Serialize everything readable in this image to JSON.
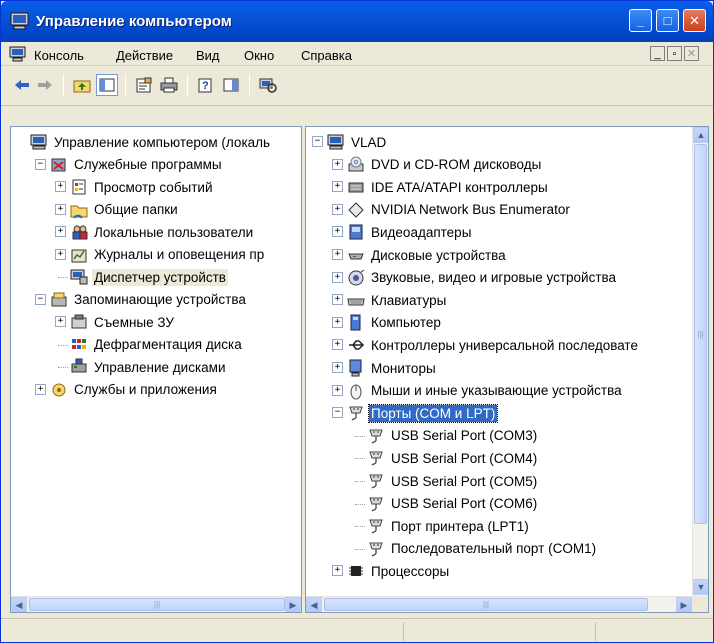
{
  "window": {
    "title": "Управление компьютером",
    "minimize": "_",
    "maximize": "□",
    "close": "✕"
  },
  "menu": [
    "Консоль",
    "Действие",
    "Вид",
    "Окно",
    "Справка"
  ],
  "mdi_controls": [
    "_",
    "▫",
    "✕"
  ],
  "left_tree": [
    {
      "label": "Управление компьютером (локаль",
      "icon": "computer-icon",
      "level": 0,
      "expander": ""
    },
    {
      "label": "Служебные программы",
      "icon": "tools-icon",
      "level": 1,
      "expander": "−"
    },
    {
      "label": "Просмотр событий",
      "icon": "event-viewer-icon",
      "level": 2,
      "expander": "+"
    },
    {
      "label": "Общие папки",
      "icon": "shared-folders-icon",
      "level": 2,
      "expander": "+"
    },
    {
      "label": "Локальные пользователи",
      "icon": "users-icon",
      "level": 2,
      "expander": "+"
    },
    {
      "label": "Журналы и оповещения пр",
      "icon": "logs-icon",
      "level": 2,
      "expander": "+"
    },
    {
      "label": "Диспетчер устройств",
      "icon": "device-manager-icon",
      "level": 2,
      "expander": "",
      "highlight": true
    },
    {
      "label": "Запоминающие устройства",
      "icon": "storage-icon",
      "level": 1,
      "expander": "−"
    },
    {
      "label": "Съемные ЗУ",
      "icon": "removable-storage-icon",
      "level": 2,
      "expander": "+"
    },
    {
      "label": "Дефрагментация диска",
      "icon": "defrag-icon",
      "level": 2,
      "expander": ""
    },
    {
      "label": "Управление дисками",
      "icon": "disk-management-icon",
      "level": 2,
      "expander": ""
    },
    {
      "label": "Службы и приложения",
      "icon": "services-icon",
      "level": 1,
      "expander": "+"
    }
  ],
  "right_tree": [
    {
      "label": "VLAD",
      "icon": "computer-icon",
      "level": 0,
      "expander": "−"
    },
    {
      "label": "DVD и CD-ROM дисководы",
      "icon": "cdrom-icon",
      "level": 1,
      "expander": "+"
    },
    {
      "label": "IDE ATA/ATAPI контроллеры",
      "icon": "ide-controller-icon",
      "level": 1,
      "expander": "+"
    },
    {
      "label": "NVIDIA Network Bus Enumerator",
      "icon": "bus-enumerator-icon",
      "level": 1,
      "expander": "+"
    },
    {
      "label": "Видеоадаптеры",
      "icon": "display-adapter-icon",
      "level": 1,
      "expander": "+"
    },
    {
      "label": "Дисковые устройства",
      "icon": "disk-drive-icon",
      "level": 1,
      "expander": "+"
    },
    {
      "label": "Звуковые, видео и игровые устройства",
      "icon": "sound-icon",
      "level": 1,
      "expander": "+"
    },
    {
      "label": "Клавиатуры",
      "icon": "keyboard-icon",
      "level": 1,
      "expander": "+"
    },
    {
      "label": "Компьютер",
      "icon": "computer-node-icon",
      "level": 1,
      "expander": "+"
    },
    {
      "label": "Контроллеры универсальной последовате",
      "icon": "usb-icon",
      "level": 1,
      "expander": "+"
    },
    {
      "label": "Мониторы",
      "icon": "monitor-icon",
      "level": 1,
      "expander": "+"
    },
    {
      "label": "Мыши и иные указывающие устройства",
      "icon": "mouse-icon",
      "level": 1,
      "expander": "+"
    },
    {
      "label": "Порты (COM и LPT)",
      "icon": "port-icon",
      "level": 1,
      "expander": "−",
      "selected": true
    },
    {
      "label": "USB Serial Port (COM3)",
      "icon": "port-icon",
      "level": 2,
      "expander": ""
    },
    {
      "label": "USB Serial Port (COM4)",
      "icon": "port-icon",
      "level": 2,
      "expander": ""
    },
    {
      "label": "USB Serial Port (COM5)",
      "icon": "port-icon",
      "level": 2,
      "expander": ""
    },
    {
      "label": "USB Serial Port (COM6)",
      "icon": "port-icon",
      "level": 2,
      "expander": ""
    },
    {
      "label": "Порт принтера (LPT1)",
      "icon": "port-icon",
      "level": 2,
      "expander": ""
    },
    {
      "label": "Последовательный порт (COM1)",
      "icon": "port-icon",
      "level": 2,
      "expander": ""
    },
    {
      "label": "Процессоры",
      "icon": "processor-icon",
      "level": 1,
      "expander": "+"
    }
  ],
  "scroll": {
    "up": "▲",
    "down": "▼",
    "left": "◀",
    "right": "▶",
    "grip": "|||"
  }
}
